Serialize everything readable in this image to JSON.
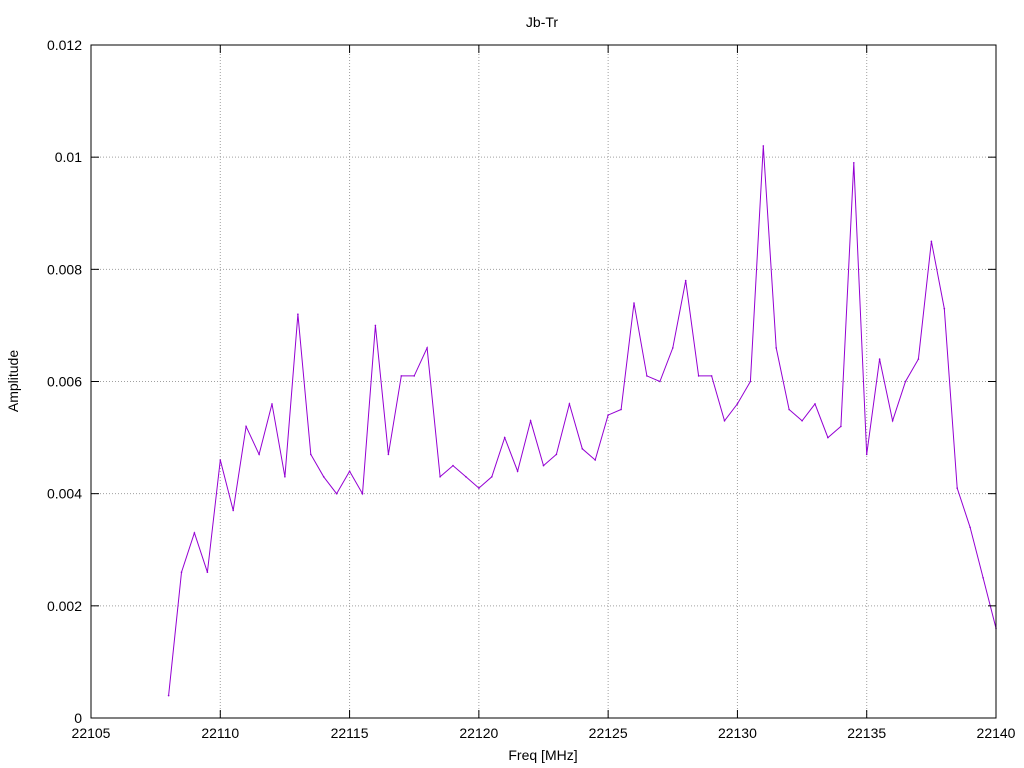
{
  "chart_data": {
    "type": "line",
    "title": "Jb-Tr",
    "xlabel": "Freq [MHz]",
    "ylabel": "Amplitude",
    "xlim": [
      22105,
      22140
    ],
    "ylim": [
      0,
      0.012
    ],
    "x_ticks": [
      22105,
      22110,
      22115,
      22120,
      22125,
      22130,
      22135,
      22140
    ],
    "x_tick_labels": [
      "22105",
      "22110",
      "22115",
      "22120",
      "22125",
      "22130",
      "22135",
      "22140"
    ],
    "y_ticks": [
      0,
      0.002,
      0.004,
      0.006,
      0.008,
      0.01,
      0.012
    ],
    "y_tick_labels": [
      "0",
      "0.002",
      "0.004",
      "0.006",
      "0.008",
      "0.01",
      "0.012"
    ],
    "grid": true,
    "legend": "none",
    "series": [
      {
        "color": "#9400d3",
        "x": [
          22108,
          22108.5,
          22109,
          22109.5,
          22110,
          22110.5,
          22111,
          22111.5,
          22112,
          22112.5,
          22113,
          22113.5,
          22114,
          22114.5,
          22115,
          22115.5,
          22116,
          22116.5,
          22117,
          22117.5,
          22118,
          22118.5,
          22119,
          22119.5,
          22120,
          22120.5,
          22121,
          22121.5,
          22122,
          22122.5,
          22123,
          22123.5,
          22124,
          22124.5,
          22125,
          22125.5,
          22126,
          22126.5,
          22127,
          22127.5,
          22128,
          22128.5,
          22129,
          22129.5,
          22130,
          22130.5,
          22131,
          22131.5,
          22132,
          22132.5,
          22133,
          22133.5,
          22134,
          22134.5,
          22135,
          22135.5,
          22136,
          22136.5,
          22137,
          22137.5,
          22138,
          22138.5,
          22139,
          22139.5,
          22140
        ],
        "y": [
          0.0004,
          0.0026,
          0.0033,
          0.0026,
          0.0046,
          0.0037,
          0.0052,
          0.0047,
          0.0056,
          0.0043,
          0.0072,
          0.0047,
          0.0043,
          0.004,
          0.0044,
          0.004,
          0.007,
          0.0047,
          0.0061,
          0.0061,
          0.0066,
          0.0043,
          0.0045,
          0.0043,
          0.0041,
          0.0043,
          0.005,
          0.0044,
          0.0053,
          0.0045,
          0.0047,
          0.0056,
          0.0048,
          0.0046,
          0.0054,
          0.0055,
          0.0074,
          0.0061,
          0.006,
          0.0066,
          0.0078,
          0.0061,
          0.0061,
          0.0053,
          0.0056,
          0.006,
          0.0102,
          0.0066,
          0.0055,
          0.0053,
          0.0056,
          0.005,
          0.0052,
          0.0099,
          0.0047,
          0.0064,
          0.0053,
          0.006,
          0.0064,
          0.0085,
          0.0073,
          0.0041,
          0.0034,
          0.0025,
          0.0016
        ]
      }
    ]
  }
}
